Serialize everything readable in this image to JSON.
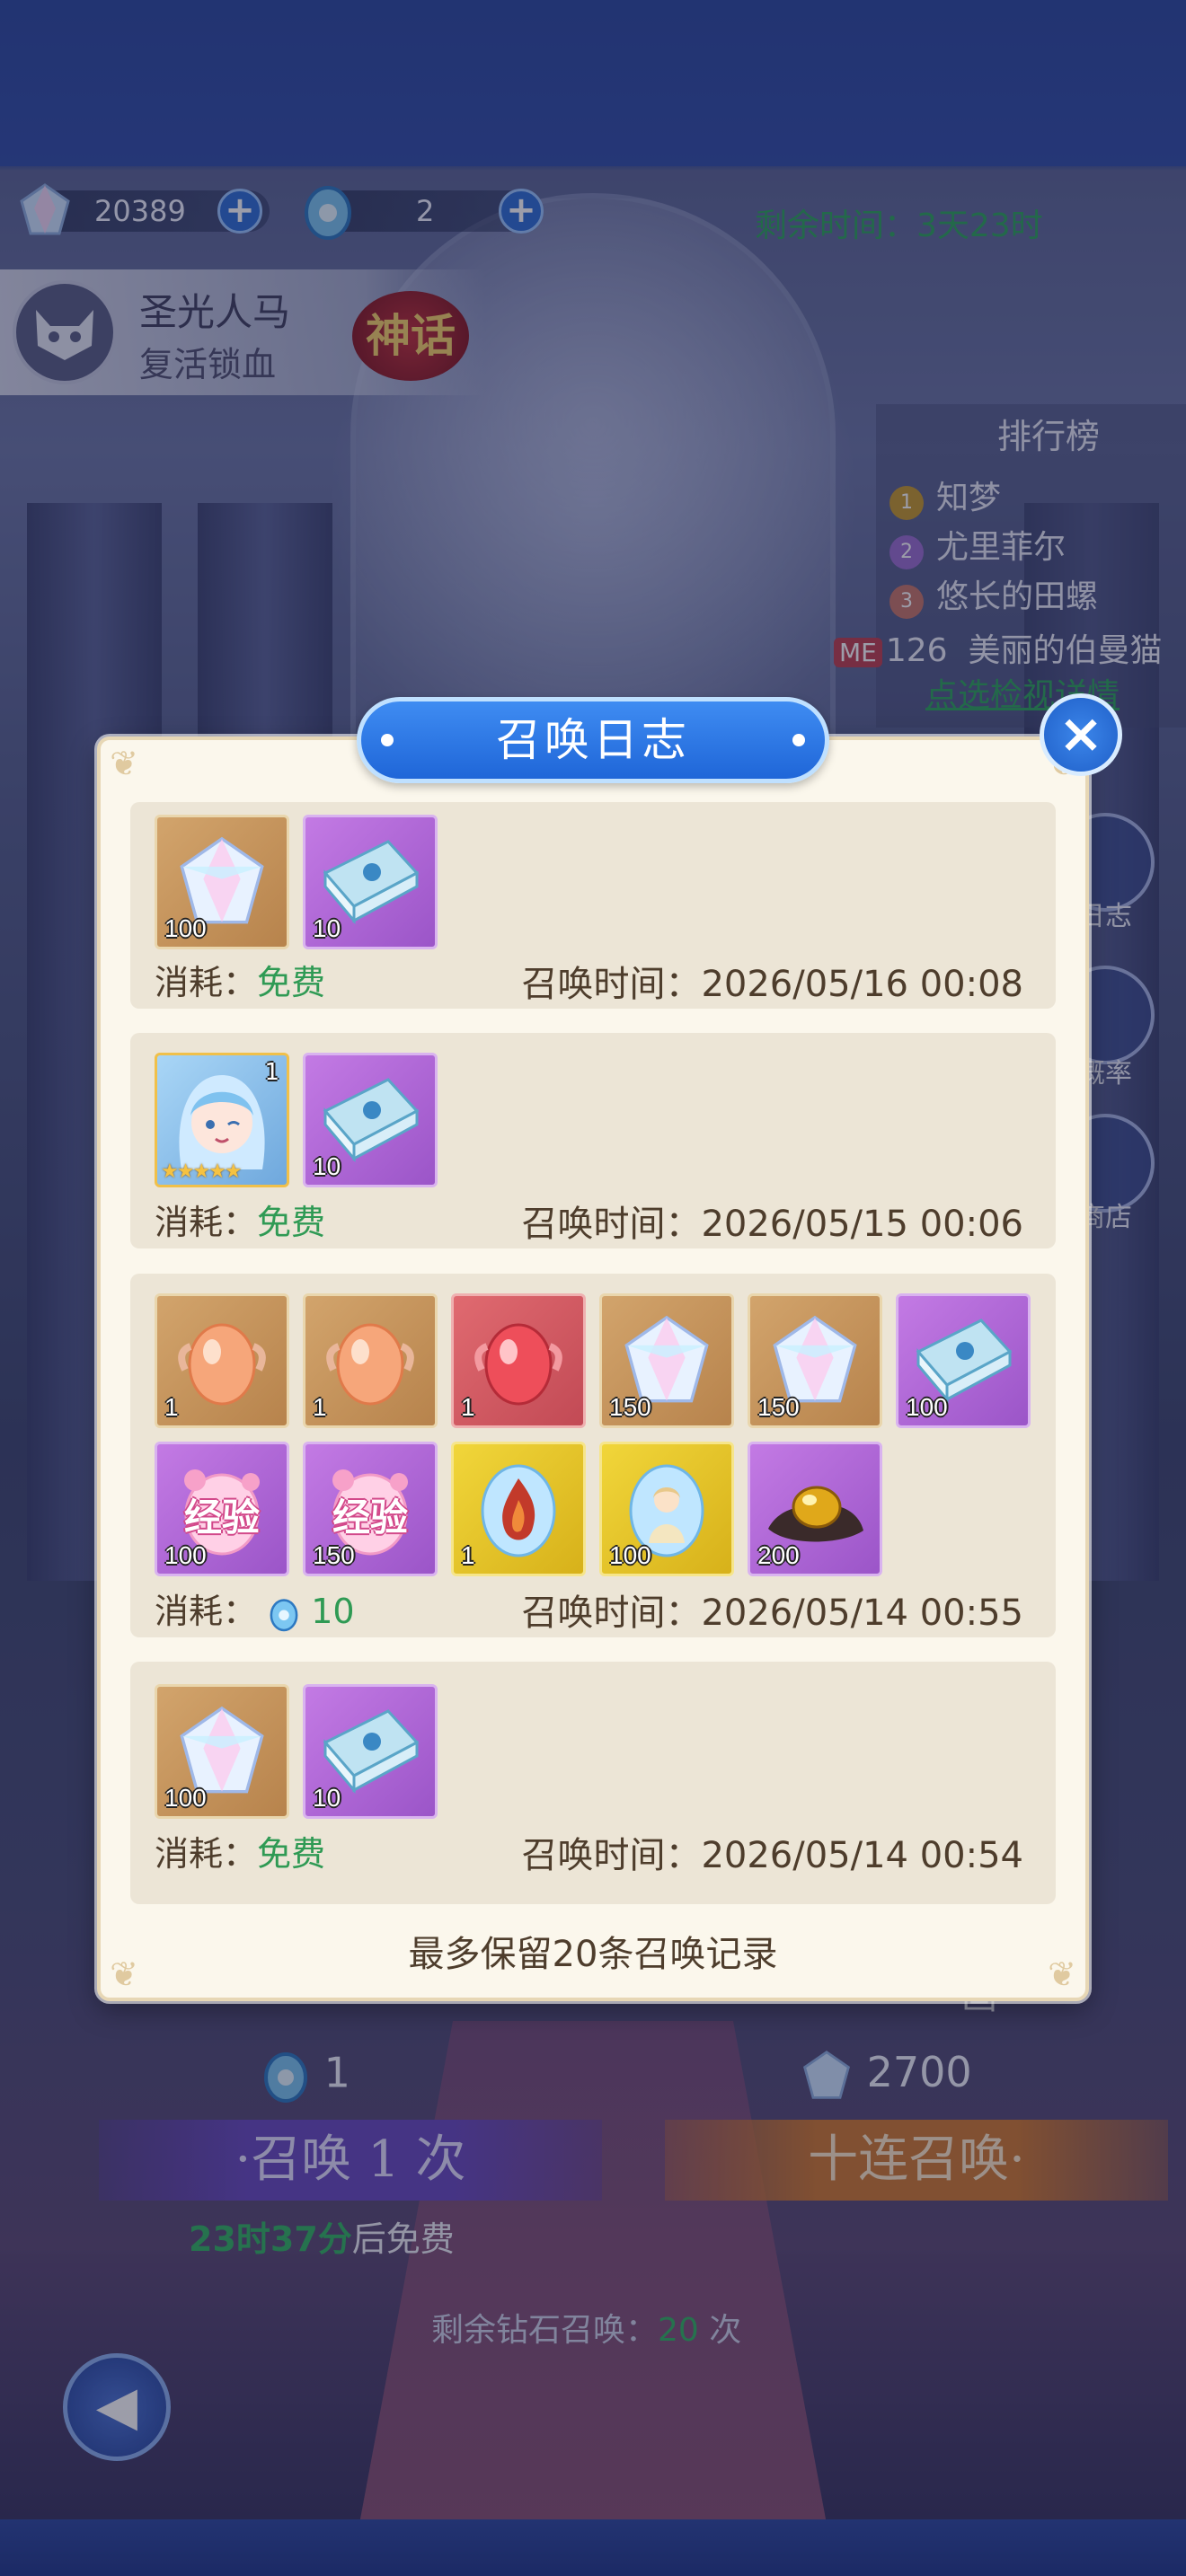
{
  "currency": {
    "crystals": "20389",
    "eggs": "2"
  },
  "remaining_time": "剩余时间：3天23时",
  "hero": {
    "name": "圣光人马",
    "skill": "复活锁血",
    "rarity": "神话"
  },
  "leaderboard": {
    "title": "排行榜",
    "rows": [
      {
        "rank": "1",
        "name": "知梦"
      },
      {
        "rank": "2",
        "name": "尤里菲尔"
      },
      {
        "rank": "3",
        "name": "悠长的田螺"
      }
    ],
    "me_badge": "ME",
    "me_rank": "126",
    "me_name": "美丽的伯曼猫",
    "detail_link": "点选检视详情"
  },
  "side_buttons": [
    "日志",
    "概率",
    "商店"
  ],
  "modal": {
    "title": "召唤日志",
    "close": "×",
    "footer": "最多保留20条召唤记录",
    "cost_label": "消耗：",
    "time_label": "召唤时间：",
    "entries": [
      {
        "items": [
          {
            "type": "crystal",
            "bg": "gold",
            "qty": "100"
          },
          {
            "type": "book",
            "bg": "purple",
            "qty": "10"
          }
        ],
        "cost_free": "免费",
        "time": "2026/05/16 00:08"
      },
      {
        "items": [
          {
            "type": "hero",
            "bg": "hero",
            "qty": "",
            "level": "1",
            "stars": "★★★★★"
          },
          {
            "type": "book",
            "bg": "purple",
            "qty": "10"
          }
        ],
        "cost_free": "免费",
        "time": "2026/05/15 00:06"
      },
      {
        "items": [
          {
            "type": "orange-egg",
            "bg": "gold",
            "qty": "1"
          },
          {
            "type": "orange-egg",
            "bg": "gold",
            "qty": "1"
          },
          {
            "type": "red-egg",
            "bg": "red",
            "qty": "1"
          },
          {
            "type": "crystal",
            "bg": "gold",
            "qty": "150"
          },
          {
            "type": "crystal",
            "bg": "gold",
            "qty": "150"
          },
          {
            "type": "book",
            "bg": "purple",
            "qty": "100"
          },
          {
            "type": "exp-egg",
            "bg": "purple",
            "qty": "100",
            "text": "经验"
          },
          {
            "type": "exp-egg",
            "bg": "purple",
            "qty": "150",
            "text": "经验"
          },
          {
            "type": "fire-egg",
            "bg": "yellow",
            "qty": "1"
          },
          {
            "type": "angel-egg",
            "bg": "yellow",
            "qty": "100"
          },
          {
            "type": "gold-ore",
            "bg": "purple",
            "qty": "200"
          }
        ],
        "cost_amount": "10",
        "time": "2026/05/14 00:55"
      },
      {
        "items": [
          {
            "type": "crystal",
            "bg": "gold",
            "qty": "100"
          },
          {
            "type": "book",
            "bg": "purple",
            "qty": "10"
          }
        ],
        "cost_free": "免费",
        "time": "2026/05/14 00:54"
      }
    ]
  },
  "summon": {
    "one_cost": "1",
    "ten_cost": "2700",
    "one_label": "·召唤 1 次",
    "ten_label": "十连召唤·",
    "free_timer": "23时37分",
    "free_suffix": "后免费",
    "diamond_left_prefix": "剩余钻石召唤：",
    "diamond_left_count": "20",
    "diamond_left_suffix": " 次",
    "hidden_label": "画"
  },
  "colors": {
    "accent_blue": "#2f6fd6",
    "free_green": "#2f9a54",
    "modal_bg": "#fbf7ec",
    "entry_bg": "#ece5d6"
  }
}
